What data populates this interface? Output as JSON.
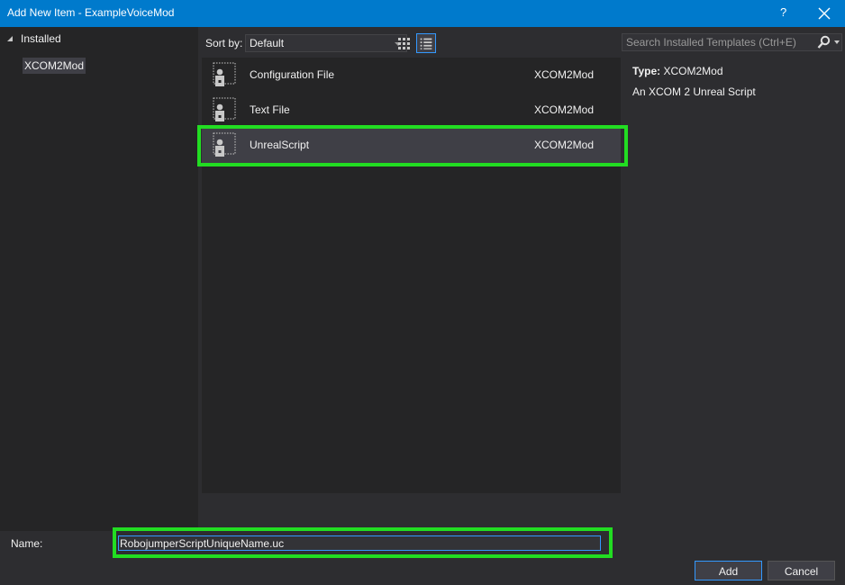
{
  "window": {
    "title": "Add New Item - ExampleVoiceMod",
    "help_label": "?"
  },
  "sidebar": {
    "header": "Installed",
    "items": [
      {
        "label": "XCOM2Mod"
      }
    ]
  },
  "toolbar": {
    "sort_label": "Sort by:",
    "sort_value": "Default",
    "search_placeholder": "Search Installed Templates (Ctrl+E)"
  },
  "templates": [
    {
      "name": "Configuration File",
      "category": "XCOM2Mod"
    },
    {
      "name": "Text File",
      "category": "XCOM2Mod"
    },
    {
      "name": "UnrealScript",
      "category": "XCOM2Mod",
      "selected": true
    }
  ],
  "details": {
    "type_label": "Type:",
    "type_value": "XCOM2Mod",
    "description": "An XCOM 2 Unreal Script"
  },
  "footer": {
    "name_label": "Name:",
    "name_value": "RobojumperScriptUniqueName.uc",
    "add_label": "Add",
    "cancel_label": "Cancel"
  },
  "colors": {
    "titlebar": "#007acc",
    "background": "#2d2d30",
    "highlight_annotation": "#22dd22"
  }
}
